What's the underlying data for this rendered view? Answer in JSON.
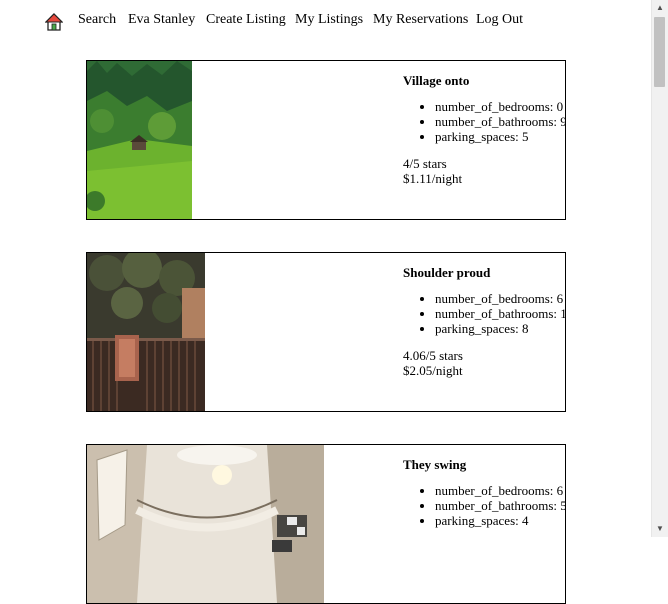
{
  "nav": {
    "home_icon": "home-icon",
    "items": [
      "Search",
      "Eva Stanley",
      "Create Listing",
      "My Listings",
      "My Reservations",
      "Log Out"
    ]
  },
  "listings": [
    {
      "title": "Village onto",
      "attributes": [
        "number_of_bedrooms: 0",
        "number_of_bathrooms: 9",
        "parking_spaces: 5"
      ],
      "rating": "4/5 stars",
      "price": "$1.11/night"
    },
    {
      "title": "Shoulder proud",
      "attributes": [
        "number_of_bedrooms: 6",
        "number_of_bathrooms: 1",
        "parking_spaces: 8"
      ],
      "rating": "4.06/5 stars",
      "price": "$2.05/night"
    },
    {
      "title": "They swing",
      "attributes": [
        "number_of_bedrooms: 6",
        "number_of_bathrooms: 5",
        "parking_spaces: 4"
      ]
    }
  ],
  "colors": {
    "border": "#000000",
    "text": "#000000",
    "scrollbar_thumb": "#c1c1c1"
  }
}
